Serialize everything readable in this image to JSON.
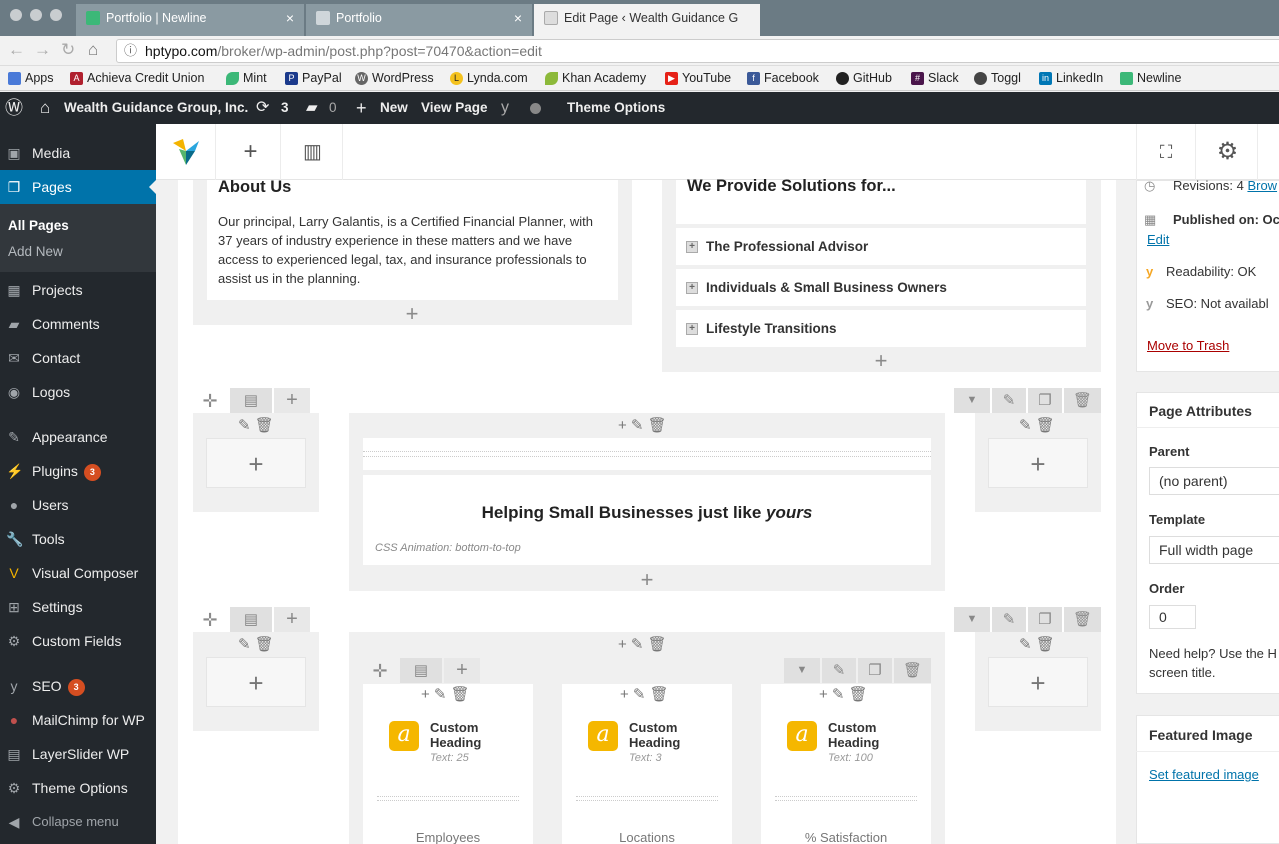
{
  "browser": {
    "tabs": [
      {
        "label": "Portfolio | Newline"
      },
      {
        "label": "Portfolio"
      },
      {
        "label": "Edit Page ‹ Wealth Guidance G"
      }
    ],
    "close_glyph": "×",
    "url_host": "hptypo.com",
    "url_path": "/broker/wp-admin/post.php?post=70470&action=edit",
    "bookmarks": [
      "Apps",
      "Achieva Credit Union",
      "Mint",
      "PayPal",
      "WordPress",
      "Lynda.com",
      "Khan Academy",
      "YouTube",
      "Facebook",
      "GitHub",
      "Slack",
      "Toggl",
      "LinkedIn",
      "Newline"
    ]
  },
  "adminbar": {
    "site": "Wealth Guidance Group, Inc.",
    "updates": "3",
    "comments": "0",
    "new": "New",
    "view_page": "View Page",
    "theme_options": "Theme Options"
  },
  "sidebar": {
    "items": [
      {
        "label": "Media",
        "icon": "media-icon"
      },
      {
        "label": "Pages",
        "icon": "pages-icon"
      },
      {
        "label": "Projects",
        "icon": "projects-icon"
      },
      {
        "label": "Comments",
        "icon": "comments-icon"
      },
      {
        "label": "Contact",
        "icon": "contact-icon"
      },
      {
        "label": "Logos",
        "icon": "logos-icon"
      },
      {
        "label": "Appearance",
        "icon": "appearance-icon"
      },
      {
        "label": "Plugins",
        "icon": "plugins-icon",
        "badge": "3"
      },
      {
        "label": "Users",
        "icon": "users-icon"
      },
      {
        "label": "Tools",
        "icon": "tools-icon"
      },
      {
        "label": "Visual Composer",
        "icon": "visual-composer-icon"
      },
      {
        "label": "Settings",
        "icon": "settings-icon"
      },
      {
        "label": "Custom Fields",
        "icon": "custom-fields-icon"
      },
      {
        "label": "SEO",
        "icon": "seo-icon",
        "badge": "3"
      },
      {
        "label": "MailChimp for WP",
        "icon": "mailchimp-icon"
      },
      {
        "label": "LayerSlider WP",
        "icon": "layerslider-icon"
      },
      {
        "label": "Theme Options",
        "icon": "theme-options-icon"
      },
      {
        "label": "Collapse menu",
        "icon": "collapse-icon"
      }
    ],
    "submenu": [
      "All Pages",
      "Add New"
    ]
  },
  "content": {
    "about_title": "About Us",
    "about_text": "Our principal, Larry Galantis, is a Certified Financial Planner, with 37 years of industry experience in these matters and we have access to experienced legal, tax, and insurance professionals to assist us in the planning.",
    "solutions_title": "We Provide Solutions for...",
    "accordion": [
      "The Professional Advisor",
      "Individuals & Small Business Owners",
      "Lifestyle Transitions"
    ],
    "heading_main": "Helping Small Businesses just like ",
    "heading_em": "yours",
    "css_anim": "CSS Animation: bottom-to-top",
    "counters": [
      {
        "title": "Custom Heading",
        "sub": "Text: 25",
        "label": "Employees"
      },
      {
        "title": "Custom Heading",
        "sub": "Text: 3",
        "label": "Locations"
      },
      {
        "title": "Custom Heading",
        "sub": "Text: 100",
        "label": "% Satisfaction"
      }
    ]
  },
  "panel": {
    "revisions_label": "Revisions: 4",
    "revisions_link": "Brow",
    "published": "Published on: Oct",
    "edit": "Edit",
    "readability": "Readability: OK",
    "seo": "SEO: Not availabl",
    "trash": "Move to Trash",
    "attr_title": "Page Attributes",
    "parent_label": "Parent",
    "parent_value": "(no parent)",
    "template_label": "Template",
    "template_value": "Full width page",
    "order_label": "Order",
    "order_value": "0",
    "help1": "Need help? Use the H",
    "help2": "screen title.",
    "featured_title": "Featured Image",
    "featured_link": "Set featured image"
  },
  "colors": {
    "adminbar": "#23282d",
    "accent": "#0073aa",
    "badge": "#d54e21",
    "counter_icon": "#f5b700"
  }
}
